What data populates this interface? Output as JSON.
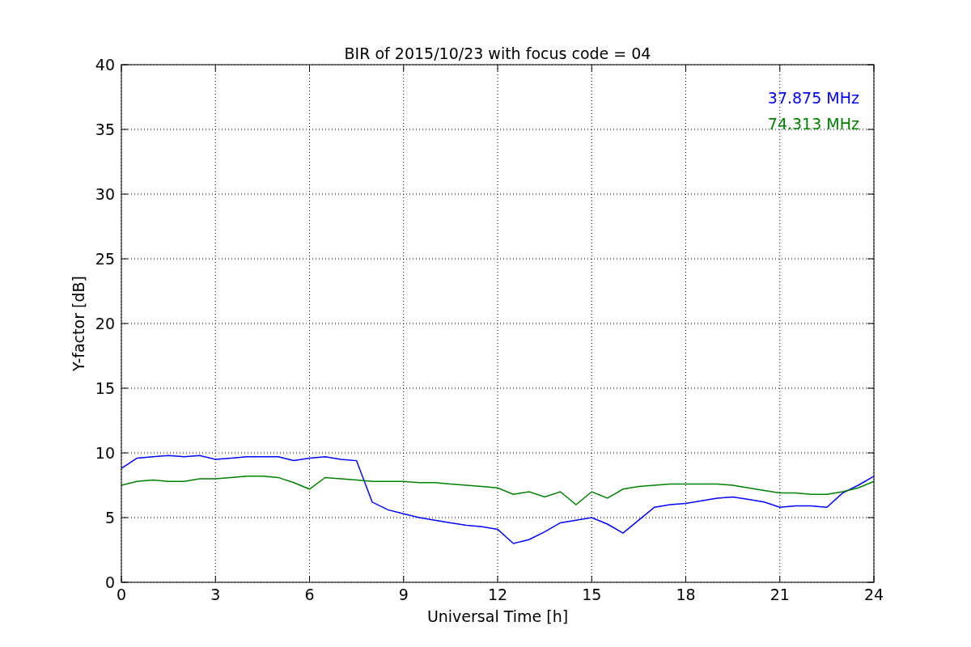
{
  "chart_data": {
    "type": "line",
    "title": "BIR of 2015/10/23 with focus code = 04",
    "xlabel": "Universal Time [h]",
    "ylabel": "Y-factor [dB]",
    "x": [
      0,
      0.5,
      1,
      1.5,
      2,
      2.5,
      3,
      3.5,
      4,
      4.5,
      5,
      5.5,
      6,
      6.5,
      7,
      7.5,
      8,
      8.5,
      9,
      9.5,
      10,
      10.5,
      11,
      11.5,
      12,
      12.5,
      13,
      13.5,
      14,
      14.5,
      15,
      15.5,
      16,
      16.5,
      17,
      17.5,
      18,
      18.5,
      19,
      19.5,
      20,
      20.5,
      21,
      21.5,
      22,
      22.5,
      23,
      23.5,
      24
    ],
    "series": [
      {
        "name": "37.875 MHz",
        "color": "#0000ff",
        "values": [
          8.8,
          9.6,
          9.7,
          9.8,
          9.7,
          9.8,
          9.5,
          9.6,
          9.7,
          9.7,
          9.7,
          9.4,
          9.6,
          9.7,
          9.5,
          9.4,
          6.2,
          5.6,
          5.3,
          5.0,
          4.8,
          4.6,
          4.4,
          4.3,
          4.1,
          3.0,
          3.3,
          3.9,
          4.6,
          4.8,
          5.0,
          4.5,
          3.8,
          4.8,
          5.8,
          6.0,
          6.1,
          6.3,
          6.5,
          6.6,
          6.4,
          6.2,
          5.8,
          5.9,
          5.9,
          5.8,
          6.9,
          7.5,
          8.2
        ]
      },
      {
        "name": "74.313 MHz",
        "color": "#008000",
        "values": [
          7.5,
          7.8,
          7.9,
          7.8,
          7.8,
          8.0,
          8.0,
          8.1,
          8.2,
          8.2,
          8.1,
          7.7,
          7.2,
          8.1,
          8.0,
          7.9,
          7.8,
          7.8,
          7.8,
          7.7,
          7.7,
          7.6,
          7.5,
          7.4,
          7.3,
          6.8,
          7.0,
          6.6,
          7.0,
          6.0,
          7.0,
          6.5,
          7.2,
          7.4,
          7.5,
          7.6,
          7.6,
          7.6,
          7.6,
          7.5,
          7.3,
          7.1,
          6.9,
          6.9,
          6.8,
          6.8,
          7.0,
          7.3,
          7.8
        ]
      }
    ],
    "xlim": [
      0,
      24
    ],
    "ylim": [
      0,
      40
    ],
    "xticks": [
      0,
      3,
      6,
      9,
      12,
      15,
      18,
      21,
      24
    ],
    "yticks": [
      0,
      5,
      10,
      15,
      20,
      25,
      30,
      35,
      40
    ],
    "grid": true
  }
}
